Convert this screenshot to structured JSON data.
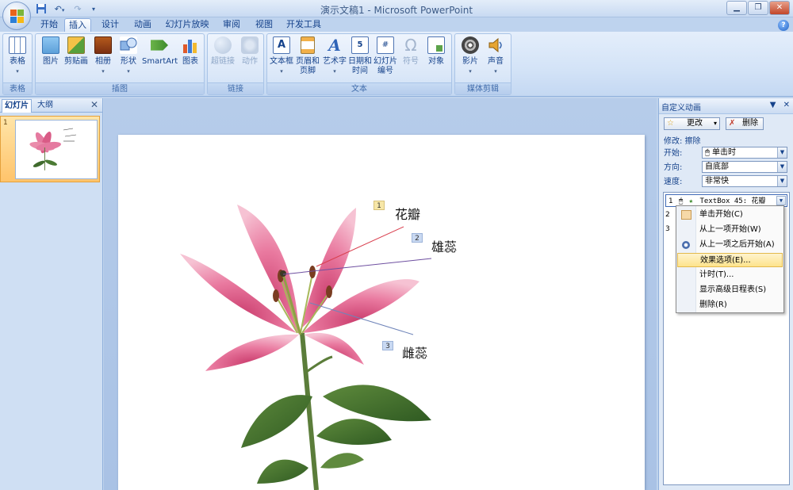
{
  "window": {
    "title": "演示文稿1 - Microsoft PowerPoint"
  },
  "tabs": [
    "开始",
    "插入",
    "设计",
    "动画",
    "幻灯片放映",
    "审阅",
    "视图",
    "开发工具"
  ],
  "active_tab": "插入",
  "ribbon": {
    "groups": {
      "table": "表格",
      "illustrations": "插图",
      "links": "链接",
      "text": "文本",
      "media": "媒体剪辑"
    },
    "buttons": {
      "table": "表格",
      "picture": "图片",
      "clipart": "剪贴画",
      "album": "相册",
      "shapes": "形状",
      "smartart": "SmartArt",
      "chart": "图表",
      "hyperlink": "超链接",
      "action": "动作",
      "textbox": "文本框",
      "header_footer_1": "页眉和",
      "header_footer_2": "页脚",
      "wordart": "艺术字",
      "datetime_1": "日期和",
      "datetime_2": "时间",
      "slidenum_1": "幻灯片",
      "slidenum_2": "编号",
      "symbol": "符号",
      "object": "对象",
      "movie": "影片",
      "sound": "声音"
    }
  },
  "left_pane": {
    "tab_slides": "幻灯片",
    "tab_outline": "大纲",
    "slide_number": "1"
  },
  "slide": {
    "callouts": [
      {
        "num": "1",
        "text": "花瓣"
      },
      {
        "num": "2",
        "text": "雄蕊"
      },
      {
        "num": "3",
        "text": "雌蕊"
      }
    ]
  },
  "task_pane": {
    "title": "自定义动画",
    "change_btn": "更改",
    "remove_btn": "删除",
    "modify_label": "修改: 擦除",
    "start_label": "开始:",
    "start_value": "单击时",
    "direction_label": "方向:",
    "direction_value": "自底部",
    "speed_label": "速度:",
    "speed_value": "非常快",
    "list": [
      {
        "num": "1",
        "text": "TextBox 45: 花瓣"
      },
      {
        "num": "2",
        "text": ""
      },
      {
        "num": "3",
        "text": ""
      }
    ]
  },
  "context_menu": {
    "items": [
      "单击开始(C)",
      "从上一项开始(W)",
      "从上一项之后开始(A)",
      "效果选项(E)...",
      "计时(T)...",
      "显示高级日程表(S)",
      "删除(R)"
    ],
    "highlighted": "效果选项(E)..."
  },
  "colors": {
    "ribbon_bg": "#d3e3f7",
    "accent": "#15428b",
    "highlight": "#fde38c",
    "callout_box_1": "#f7e7a8",
    "callout_box_2": "#c9d9f2"
  }
}
